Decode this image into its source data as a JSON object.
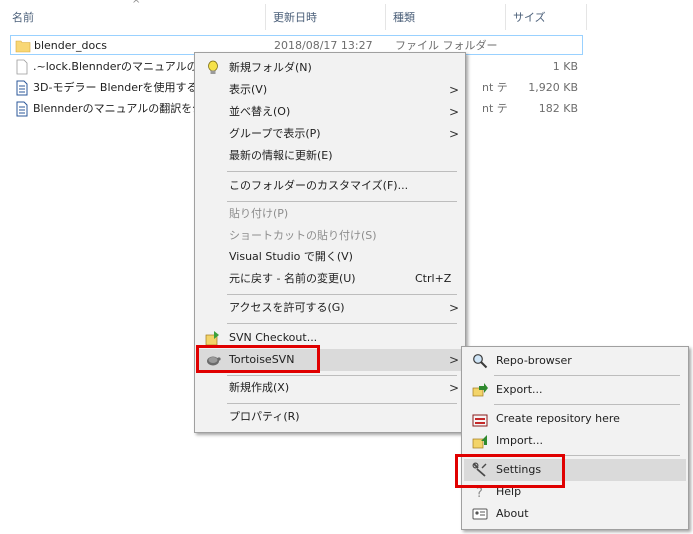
{
  "columns": {
    "name": "名前",
    "modified": "更新日時",
    "type": "種類",
    "size": "サイズ"
  },
  "files": [
    {
      "name": "blender_docs",
      "date": "2018/08/17 13:27",
      "type": "ファイル フォルダー",
      "size": ""
    },
    {
      "name": ".~lock.Blennderのマニュアルの翻",
      "date": "",
      "type": "",
      "size": "1 KB"
    },
    {
      "name": "3D-モデラー Blenderを使用する.oc",
      "date": "",
      "type": "nt テ",
      "size": "1,920 KB"
    },
    {
      "name": "Blennderのマニュアルの翻訳を公",
      "date": "",
      "type": "nt テ",
      "size": "182 KB"
    }
  ],
  "context_menu": {
    "new_folder": "新規フォルダ(N)",
    "view": "表示(V)",
    "sort": "並べ替え(O)",
    "group": "グループで表示(P)",
    "refresh": "最新の情報に更新(E)",
    "customize": "このフォルダーのカスタマイズ(F)...",
    "paste": "貼り付け(P)",
    "paste_shortcut": "ショートカットの貼り付け(S)",
    "open_vs": "Visual Studio で開く(V)",
    "undo": "元に戻す - 名前の変更(U)",
    "undo_shortcut": "Ctrl+Z",
    "give_access": "アクセスを許可する(G)",
    "svn_checkout": "SVN Checkout...",
    "tortoisesvn": "TortoiseSVN",
    "new": "新規作成(X)",
    "properties": "プロパティ(R)"
  },
  "submenu": {
    "repo_browser": "Repo-browser",
    "export": "Export...",
    "create_repo": "Create repository here",
    "import": "Import...",
    "settings": "Settings",
    "help": "Help",
    "about": "About"
  },
  "colors": {
    "menu_bg": "#f2f2f2",
    "hover_bg": "#dadada",
    "highlight_red": "#e00000",
    "selected_border": "#99d1ff",
    "folder_yellow": "#f8d775"
  }
}
